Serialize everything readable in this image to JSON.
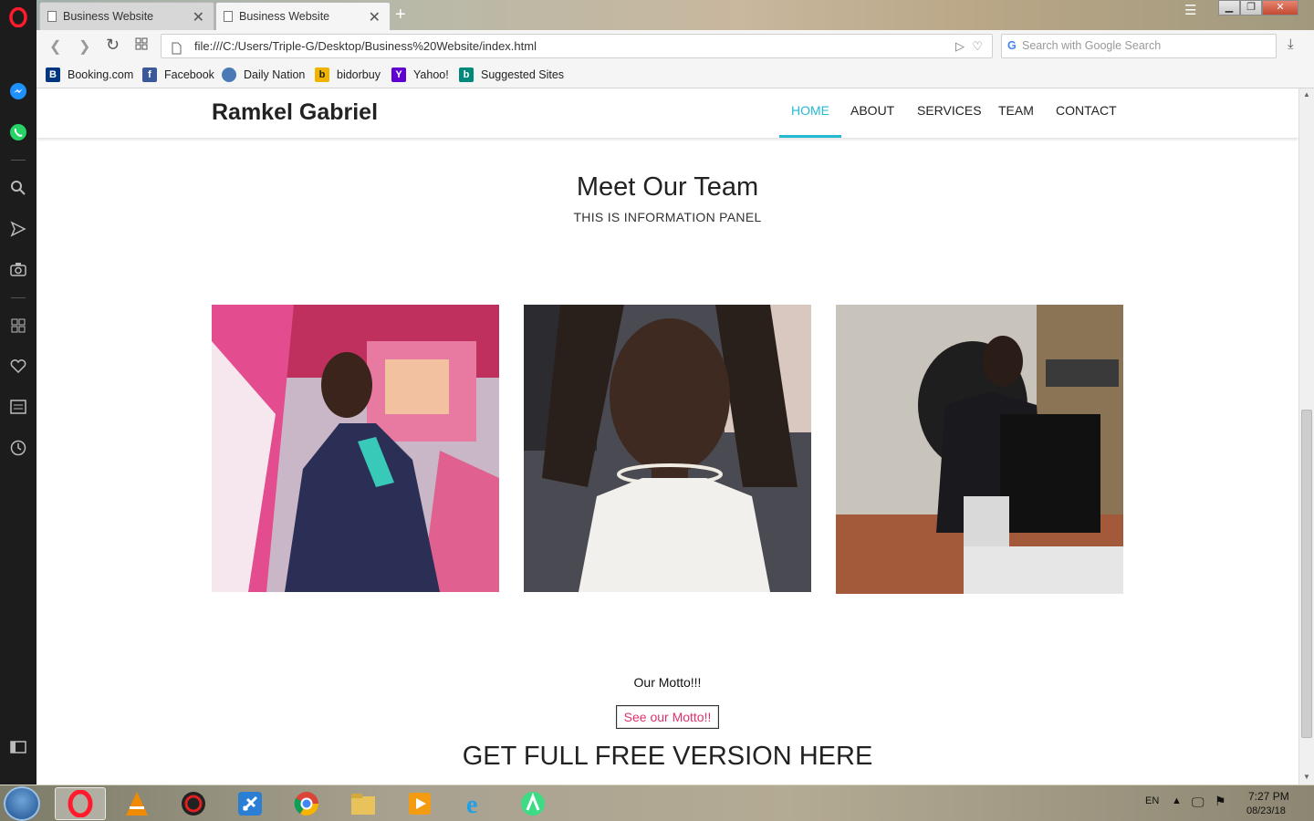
{
  "browser": {
    "tabs": [
      {
        "title": "Business Website",
        "active": false
      },
      {
        "title": "Business Website",
        "active": true
      }
    ],
    "url": "file:///C:/Users/Triple-G/Desktop/Business%20Website/index.html",
    "search_placeholder": "Search with Google Search",
    "bookmarks": [
      {
        "label": "Booking.com",
        "icon": "booking-icon",
        "color": "#003580"
      },
      {
        "label": "Facebook",
        "icon": "facebook-icon",
        "color": "#3b5998"
      },
      {
        "label": "Daily Nation",
        "icon": "globe-icon",
        "color": "#4a7ab5"
      },
      {
        "label": "bidorbuy",
        "icon": "bidorbuy-icon",
        "color": "#f0b400"
      },
      {
        "label": "Yahoo!",
        "icon": "yahoo-icon",
        "color": "#5f01d1"
      },
      {
        "label": "Suggested Sites",
        "icon": "bing-icon",
        "color": "#00897b"
      }
    ]
  },
  "site": {
    "brand": "Ramkel Gabriel",
    "nav": [
      "HOME",
      "ABOUT",
      "SERVICES",
      "TEAM",
      "CONTACT"
    ],
    "active_nav": "HOME",
    "accent_color": "#26b9d4",
    "team_title": "Meet Our Team",
    "team_subtitle": "THIS IS INFORMATION PANEL",
    "motto_label": "Our Motto!!!",
    "motto_button": "See our Motto!!",
    "get_full": "GET FULL FREE VERSION HERE"
  },
  "taskbar": {
    "apps": [
      "opera",
      "vlc",
      "app-red",
      "airplane",
      "chrome",
      "file-explorer",
      "media-player",
      "internet-explorer",
      "android-studio"
    ],
    "language": "EN",
    "time": "7:27 PM",
    "date": "08/23/18"
  }
}
